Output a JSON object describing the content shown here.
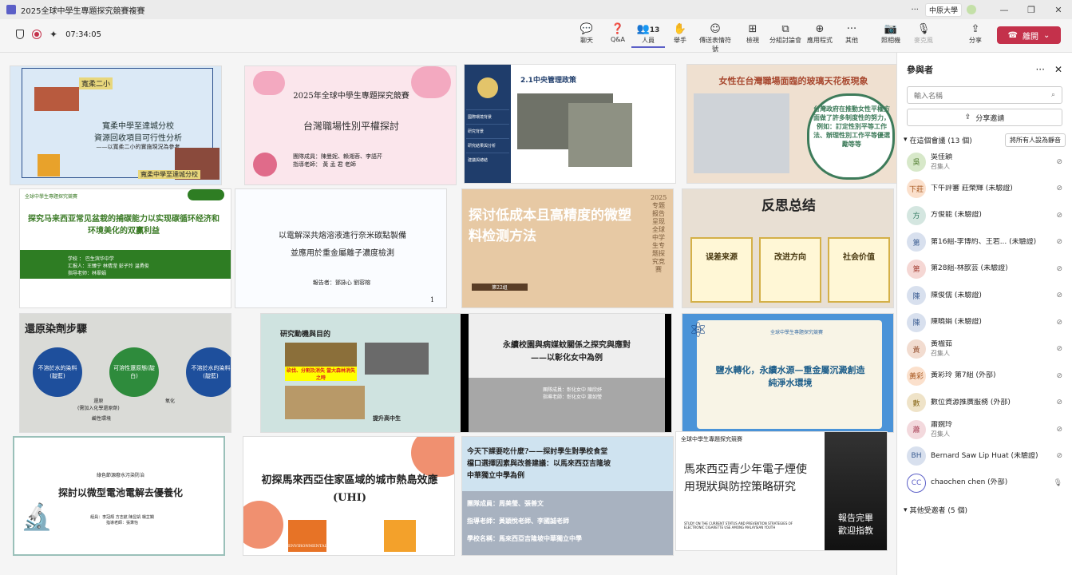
{
  "titlebar": {
    "title": "2025全球中學生專題探究競賽複賽",
    "org": "中原大學",
    "org_badge": "裴"
  },
  "toolbar": {
    "timer": "07:34:05",
    "buttons": [
      {
        "label": "聊天",
        "icon": "chat-icon"
      },
      {
        "label": "Q&A",
        "icon": "qa-icon"
      },
      {
        "label": "人員",
        "count": "13",
        "icon": "people-icon"
      },
      {
        "label": "舉手",
        "icon": "raise-hand-icon"
      },
      {
        "label": "傳送表情符號",
        "icon": "emoji-icon"
      },
      {
        "label": "檢視",
        "icon": "view-icon"
      },
      {
        "label": "分組討論會",
        "icon": "breakout-icon"
      },
      {
        "label": "應用程式",
        "icon": "apps-icon"
      },
      {
        "label": "其他",
        "icon": "more-icon"
      },
      {
        "label": "照相機",
        "icon": "camera-off-icon"
      },
      {
        "label": "麥克風",
        "icon": "mic-off-icon"
      },
      {
        "label": "分享",
        "icon": "share-icon"
      }
    ],
    "leave_label": "離開"
  },
  "tiles": [
    {
      "label": "寬柔二小",
      "title": "寬柔中學至達城分校\n資源回收項目可行性分析",
      "sub": "——以寬柔二小的實施現況為參考",
      "foot": "寬柔中學至達城分校"
    },
    {
      "title": "2025年全球中學生專題探究競賽",
      "sub": "台灣職場性別平權探討",
      "foot": "團隊成員：陳曼妮、賴湘蓉、李語芹\n指導老師： 黃 孟 君 老師"
    },
    {
      "title": "2.1中央管理政策",
      "side": [
        "國際環境背景",
        "研究背景",
        "研究結果與分析",
        "建議與總結"
      ]
    },
    {
      "title": "女性在台灣職場面臨的玻璃天花板現象",
      "sub": "台灣政府在推動女性平權方面做了許多制度性的努力，例如：訂定性別平等工作法、辦理性別工作平等優選勵等等"
    },
    {
      "label": "全球中學生專題探究競賽",
      "title": "探究马来西亚常见盆栽的捕碳能力以实现碳循环经济和环境美化的双赢利益",
      "foot": "学校 ： 巴生滨华中学\n汇报人：王臻宁 林倩滢 彭子玲 温勇俊\n指导老师：林翠娟"
    },
    {
      "title": "以電解深共熔溶液進行奈米碳點製備\n並應用於重金屬離子濃度檢測",
      "foot": "報告者：鄧詠心 劉容榕",
      "page": "1"
    },
    {
      "title": "探讨低成本且高精度的微塑料检测方法",
      "side": "2025专题报告呈现 全球中学生专题探究竞赛",
      "foot": "第22组"
    },
    {
      "title": "反思总结",
      "cols": [
        "误差来源",
        "改进方向",
        "社会价值"
      ]
    },
    {
      "title": "還原染劑步驟",
      "nodes": [
        "不溶於水的染料(靛藍)",
        "可溶性還原態(靛白)",
        "不溶於水的染料(靛藍)"
      ],
      "labels": [
        "還原\n(需加入化學還原劑)",
        "氧化",
        "鹼性環境"
      ]
    },
    {
      "title": "研究動機與目的",
      "sub": "砍伐、分割及消失 當大森林消失之時",
      "foot": "提升高中生"
    },
    {
      "title": "永續校園與病媒蚊關係之探究與應對\n——以彰化女中為例",
      "foot": "團隊成員：彰化女中 陳欣妤\n指導老師：彰化女中 蕭如瑩"
    },
    {
      "title": "鹽水轉化，永續水源—重金屬沉澱創造純淨水環境",
      "label": "全球中學生專題探究競賽"
    },
    {
      "title": "探討以微型電池電解去優養化",
      "label": "綠色節源廢水污染防治",
      "foot": "組員：李冠頡 方志航 陳昱凱 楊芷嫻\n指導老師：張秉怡"
    },
    {
      "title": "初探馬來西亞住家區域的城市熱島效應\n(UHI)",
      "badge": "ENVIRONMENTAL"
    },
    {
      "title": "今天下課要吃什麼?——探討學生對學校食堂檔口選擇因素與改善建議：以馬來西亞吉隆坡中華獨立中學為例",
      "foot": "團隊成員：周美瑩、張善文\n指導老師：黃穎悅老師、李國誠老師\n學校名稱：馬來西亞吉隆坡中華獨立中學"
    },
    {
      "label": "全球中學生專題探究競賽",
      "title": "馬來西亞青少年電子煙使用現狀與防控策略研究",
      "sub": "STUDY ON THE CURRENT STATUS AND PREVENTION STRATEGIES OF ELECTRONIC CIGARETTE USE AMONG MALAYSIAN YOUTH",
      "foot": "報告完畢\n歡迎指教"
    }
  ],
  "panel": {
    "title": "參與者",
    "search_placeholder": "輸入名稱",
    "share_label": "分享邀請",
    "in_meeting": "在這個會議 (13 個)",
    "mute_all": "將所有人設為靜音",
    "others": "其他受邀者 (5 個)",
    "people": [
      {
        "initials": "吳",
        "name": "吳佳穎",
        "role": "召集人",
        "color": "#d7e8c9",
        "fg": "#4d7a2d"
      },
      {
        "initials": "下莊",
        "name": "下午評審 莊榮輝 (未驗證)",
        "role": "",
        "color": "#fbe0cc",
        "fg": "#a5541b"
      },
      {
        "initials": "方",
        "name": "方俊能 (未驗證)",
        "role": "",
        "color": "#d4e6e0",
        "fg": "#337a62"
      },
      {
        "initials": "第",
        "name": "第16組-李博約、王若... (未驗證)",
        "role": "",
        "color": "#d8e0ee",
        "fg": "#3a5c91"
      },
      {
        "initials": "第",
        "name": "第28組-林歆芸 (未驗證)",
        "role": "",
        "color": "#f5d7d4",
        "fg": "#a23b2f"
      },
      {
        "initials": "陳",
        "name": "陳俊儒 (未驗證)",
        "role": "",
        "color": "#d8e0ee",
        "fg": "#3a5c91"
      },
      {
        "initials": "陳",
        "name": "陳曉娟 (未驗證)",
        "role": "",
        "color": "#d8e0ee",
        "fg": "#3a5c91"
      },
      {
        "initials": "黃",
        "name": "黃楹茹",
        "role": "召集人",
        "color": "#f2dcd0",
        "fg": "#9a5738"
      },
      {
        "initials": "黃彩",
        "name": "黃彩玲 第7組 (外部)",
        "role": "",
        "color": "#fbe0cc",
        "fg": "#a5541b"
      },
      {
        "initials": "數",
        "name": "數位資源推廣服務 (外部)",
        "role": "",
        "color": "#efe3c8",
        "fg": "#8a6a1d"
      },
      {
        "initials": "蕭",
        "name": "蕭婉玲",
        "role": "召集人",
        "color": "#f3d9dd",
        "fg": "#a63c52"
      },
      {
        "initials": "BH",
        "name": "Bernard Saw Lip Huat (未驗證)",
        "role": "",
        "color": "#d8e0ee",
        "fg": "#3a5c91"
      },
      {
        "initials": "CC",
        "name": "chaochen chen (外部)",
        "role": "",
        "color": "#ffffff",
        "fg": "#5b5fc7"
      }
    ]
  }
}
